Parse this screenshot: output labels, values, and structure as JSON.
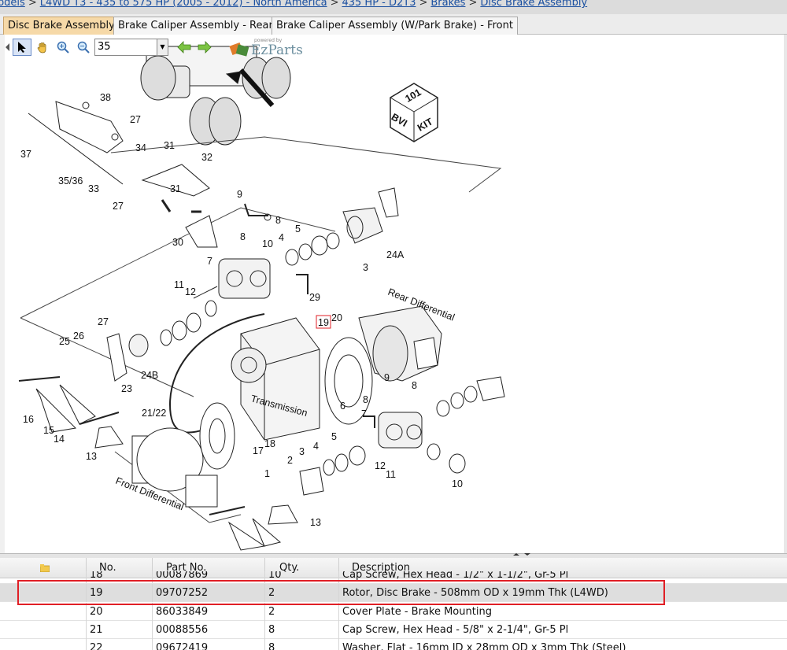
{
  "breadcrumb": {
    "items": [
      "Models",
      "L4WD T3 - 435 to 575 HP (2005 - 2012) - North America",
      "435 HP - D2T3",
      "Brakes",
      "Disc Brake Assembly"
    ],
    "separator": ">"
  },
  "tabs": [
    {
      "label": "Disc Brake Assembly",
      "active": true
    },
    {
      "label": "Brake Caliper Assembly - Rear",
      "active": false
    },
    {
      "label": "Brake Caliper Assembly (W/Park Brake) - Front",
      "active": false
    }
  ],
  "toolbar": {
    "zoom_value": "35",
    "tools": [
      "select-arrow-icon",
      "pan-hand-icon",
      "zoom-in-icon",
      "zoom-out-icon",
      "back-arrow-icon",
      "forward-arrow-icon"
    ]
  },
  "logo": {
    "powered_by": "powered by",
    "brand": "EzParts"
  },
  "diagram": {
    "badge": {
      "top": "101",
      "left": "BVI",
      "right": "KIT"
    },
    "labels": {
      "rear_differential": "Rear Differential",
      "front_differential": "Front Differential",
      "transmission": "Transmission"
    },
    "callouts": [
      "38",
      "27",
      "37",
      "34",
      "31",
      "35/36",
      "33",
      "32",
      "27",
      "31",
      "9",
      "30",
      "8",
      "5",
      "8",
      "4",
      "10",
      "24A",
      "7",
      "3",
      "11",
      "12",
      "29",
      "27",
      "19",
      "20",
      "25",
      "26",
      "24B",
      "23",
      "9",
      "8",
      "16",
      "15",
      "14",
      "21/22",
      "6",
      "7",
      "8",
      "17",
      "18",
      "13",
      "5",
      "4",
      "3",
      "2",
      "12",
      "11",
      "10",
      "1",
      "13"
    ],
    "highlighted_callout": "19"
  },
  "table": {
    "columns": [
      "No.",
      "Part No.",
      "Qty.",
      "Description"
    ],
    "rows": [
      {
        "no": "18",
        "part": "00087869",
        "qty": "10",
        "desc": "Cap Screw, Hex Head - 1/2\" x 1-1/2\", Gr-5 Pl",
        "selected": false
      },
      {
        "no": "19",
        "part": "09707252",
        "qty": "2",
        "desc": "Rotor, Disc Brake - 508mm OD x 19mm Thk (L4WD)",
        "selected": true
      },
      {
        "no": "20",
        "part": "86033849",
        "qty": "2",
        "desc": "Cover Plate - Brake Mounting",
        "selected": false
      },
      {
        "no": "21",
        "part": "00088556",
        "qty": "8",
        "desc": "Cap Screw, Hex Head - 5/8\" x 2-1/4\", Gr-5 Pl",
        "selected": false
      },
      {
        "no": "22",
        "part": "09672419",
        "qty": "8",
        "desc": "Washer, Flat - 16mm ID x 28mm OD x 3mm Thk (Steel)",
        "selected": false
      }
    ]
  },
  "colors": {
    "active_tab": "#f6d9a8",
    "highlight": "#e01f26",
    "link": "#1a4fa0"
  }
}
